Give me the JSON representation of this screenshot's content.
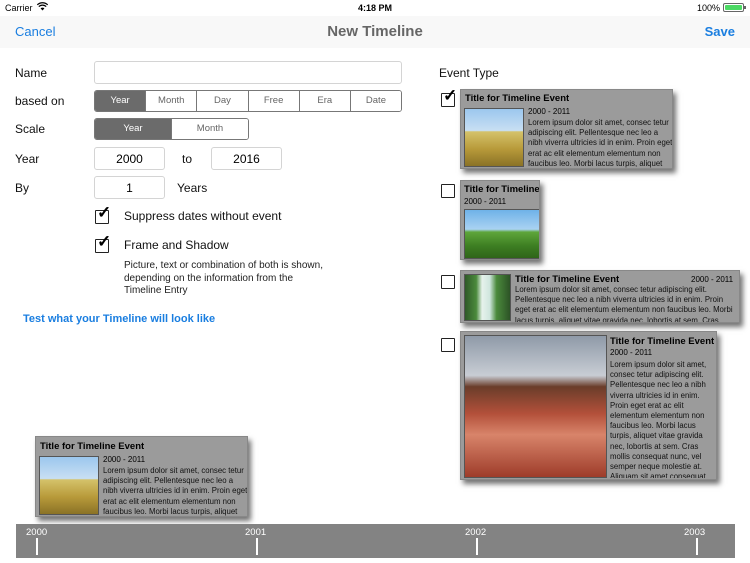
{
  "status": {
    "carrier": "Carrier",
    "time": "4:18 PM",
    "battery": "100%",
    "battery_level": 1.0
  },
  "nav": {
    "cancel": "Cancel",
    "title": "New Timeline",
    "save": "Save"
  },
  "form": {
    "name_label": "Name",
    "name_value": "",
    "based_on_label": "based on",
    "based_on_options": [
      "Year",
      "Month",
      "Day",
      "Free",
      "Era",
      "Date"
    ],
    "based_on_selected": "Year",
    "scale_label": "Scale",
    "scale_options": [
      "Year",
      "Month"
    ],
    "scale_selected": "Year",
    "year_label": "Year",
    "year_from": "2000",
    "to_label": "to",
    "year_to": "2016",
    "by_label": "By",
    "by_value": "1",
    "by_unit": "Years",
    "suppress_label": "Suppress dates without event",
    "suppress_checked": true,
    "frame_label": "Frame and Shadow",
    "frame_checked": true,
    "description": "Picture, text  or combination of both is shown, depending on the information from the Timeline Entry",
    "test_link": "Test what your Timeline will look like"
  },
  "event_type": {
    "label": "Event Type",
    "options": [
      {
        "checked": true,
        "title": "Title for Timeline Event",
        "dates": "2000 - 2011",
        "text": "Lorem ipsum dolor sit amet, consec tetur adipiscing elit. Pellentesque nec leo a nibh viverra ultricies id in enim. Proin eget erat ac elit elementum elementum non faucibus leo. Morbi lacus turpis, aliquet vitae gravida nec"
      },
      {
        "checked": false,
        "title": "Title for Timeline Event",
        "dates": "2000 - 2011"
      },
      {
        "checked": false,
        "title": "Title for Timeline Event",
        "dates": "2000 - 2011",
        "text": "Lorem ipsum dolor sit amet, consec tetur adipiscing elit. Pellentesque nec leo a nibh viverra ultricies id in enim. Proin eget erat ac elit elementum elementum non faucibus leo. Morbi lacus turpis, aliquet vitae gravida nec, lobortis at sem. Cras mollis"
      },
      {
        "checked": false,
        "title": "Title for Timeline Event",
        "dates": "2000 - 2011",
        "text": "Lorem ipsum dolor sit amet, consec tetur adipiscing elit. Pellentesque nec leo a nibh viverra ultricies id in enim. Proin eget erat ac elit elementum elementum non faucibus leo. Morbi lacus turpis, aliquet vitae gravida nec, lobortis at sem. Cras mollis consequat nunc, vel semper neque molestie at. Aliquam sit amet consequat mi"
      }
    ]
  },
  "preview": {
    "title": "Title for Timeline Event",
    "dates": "2000 - 2011",
    "text": "Lorem ipsum dolor sit amet, consec tetur adipiscing elit. Pellentesque nec leo a nibh viverra ultricies id in enim. Proin eget erat ac elit elementum elementum non faucibus leo. Morbi lacus turpis, aliquet vitae gravida nec"
  },
  "timeline": {
    "years": [
      "2000",
      "2001",
      "2002",
      "2003"
    ]
  }
}
